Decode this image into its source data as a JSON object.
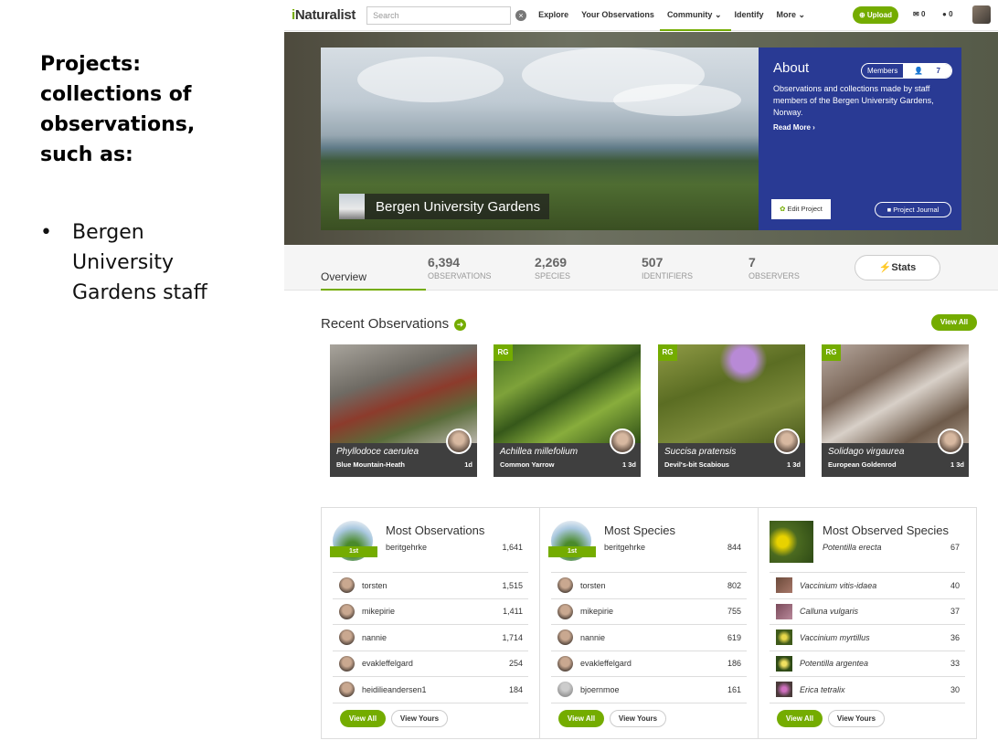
{
  "slide": {
    "title": "Projects:\ncollections of\nobservations,\nsuch as:",
    "bullet_glyph": "•",
    "bullet": "Bergen\nUniversity\nGardens staff"
  },
  "nav": {
    "logo_i": "i",
    "logo_rest": "Naturalist",
    "search_placeholder": "Search",
    "clear_glyph": "×",
    "links": [
      "Explore",
      "Your Observations",
      "Community",
      "Identify",
      "More"
    ],
    "upload": "Upload",
    "messages": "0",
    "notifications": "0"
  },
  "project": {
    "title": "Bergen University Gardens",
    "about_heading": "About",
    "members_label": "Members",
    "members_count": "7",
    "description": "Observations and collections made by staff members of the Bergen University Gardens, Norway.",
    "read_more": "Read More ›",
    "edit_button": "Edit Project",
    "journal_button": "Project Journal"
  },
  "tabs": {
    "overview": "Overview",
    "stats_button": "Stats",
    "stats": [
      {
        "num": "6,394",
        "label": "OBSERVATIONS"
      },
      {
        "num": "2,269",
        "label": "SPECIES"
      },
      {
        "num": "507",
        "label": "IDENTIFIERS"
      },
      {
        "num": "7",
        "label": "OBSERVERS"
      }
    ]
  },
  "recent": {
    "title": "Recent Observations",
    "arrow_glyph": "➜",
    "view_all": "View All",
    "items": [
      {
        "sci": "Phyllodoce caerulea",
        "common": "Blue Mountain-Heath",
        "time": "1d",
        "rg": ""
      },
      {
        "sci": "Achillea millefolium",
        "common": "Common Yarrow",
        "time": "1 3d",
        "rg": "RG"
      },
      {
        "sci": "Succisa pratensis",
        "common": "Devil's-bit Scabious",
        "time": "1 3d",
        "rg": "RG"
      },
      {
        "sci": "Solidago virgaurea",
        "common": "European Goldenrod",
        "time": "1 3d",
        "rg": "RG"
      }
    ]
  },
  "panels": [
    {
      "title": "Most Observations",
      "ribbon": "1st",
      "leader": "beritgehrke",
      "leader_value": "1,641",
      "rows": [
        {
          "name": "torsten",
          "value": "1,515"
        },
        {
          "name": "mikepirie",
          "value": "1,411"
        },
        {
          "name": "nannie",
          "value": "1,714"
        },
        {
          "name": "evakleffelgard",
          "value": "254"
        },
        {
          "name": "heidilieandersen1",
          "value": "184"
        }
      ],
      "view_all": "View All",
      "view_yours": "View Yours"
    },
    {
      "title": "Most Species",
      "ribbon": "1st",
      "leader": "beritgehrke",
      "leader_value": "844",
      "rows": [
        {
          "name": "torsten",
          "value": "802"
        },
        {
          "name": "mikepirie",
          "value": "755"
        },
        {
          "name": "nannie",
          "value": "619"
        },
        {
          "name": "evakleffelgard",
          "value": "186"
        },
        {
          "name": "bjoernmoe",
          "value": "161"
        }
      ],
      "view_all": "View All",
      "view_yours": "View Yours"
    },
    {
      "title": "Most Observed Species",
      "leader": "Potentilla erecta",
      "leader_value": "67",
      "rows": [
        {
          "name": "Vaccinium vitis-idaea",
          "value": "40"
        },
        {
          "name": "Calluna vulgaris",
          "value": "37"
        },
        {
          "name": "Vaccinium myrtillus",
          "value": "36"
        },
        {
          "name": "Potentilla argentea",
          "value": "33"
        },
        {
          "name": "Erica tetralix",
          "value": "30"
        }
      ],
      "view_all": "View All",
      "view_yours": "View Yours"
    }
  ],
  "colors": {
    "brand_green": "#74ac00",
    "about_blue": "#293a94"
  }
}
